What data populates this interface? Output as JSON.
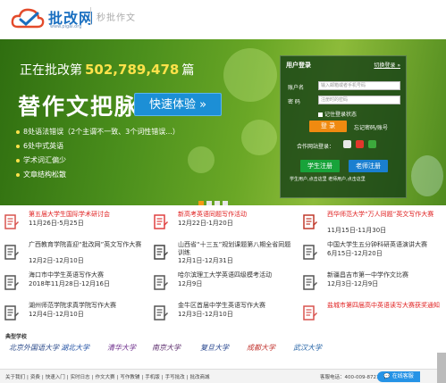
{
  "header": {
    "logo_text": "批改网",
    "logo_url": "www.pigai.org",
    "slogan": "秒批作文"
  },
  "banner": {
    "counter_prefix": "正在批改第",
    "counter_number": "502,789,478",
    "counter_suffix": "篇",
    "headline": "替作文把脉",
    "cta_label": "快速体验 »",
    "features": [
      "8处语法错误（2个主谓不一致、3个词性错误...）",
      "6处中式英语",
      "学术词汇偏少",
      "文章结构松散"
    ],
    "slide_count": 4,
    "active_slide": 0
  },
  "login": {
    "title": "用户登录",
    "switch_link": "切换登录 »",
    "account_label": "账户名",
    "account_placeholder": "输入邮箱或者手机号码",
    "password_label": "密 码",
    "password_placeholder": "注册时的密码",
    "remember_label": "记住登录状态",
    "login_button": "登 录",
    "forgot_link": "忘记密码/账号",
    "partner_label": "合作网站登录：",
    "student_register": "学生注册",
    "teacher_register": "老师注册",
    "register_links": "学生用户,点击这里 老师用户,点击这里"
  },
  "news": [
    {
      "title": "第五届大学生国际学术研讨会",
      "date": "11月26日-5月25日",
      "red": true,
      "icon": "#d9534f"
    },
    {
      "title": "新高考英语同题写作活动",
      "date": "12月22日-1月20日",
      "red": true,
      "icon": "#e04040"
    },
    {
      "title": "西华师范大学“万人同题”英文写作大赛",
      "date": "11月15日-11月30日",
      "red": true,
      "icon": "#c0392b"
    },
    {
      "title": "广西教育学院喜迎“批改网”英文写作大赛",
      "date": "12月2日-12月10日",
      "red": false,
      "icon": "#555555"
    },
    {
      "title": "山西省“十三五”规划课题第八期全省同题训练",
      "date": "12月1日-12月31日",
      "red": false,
      "icon": "#444444"
    },
    {
      "title": "中国大学生五分钟科研英语演讲大赛",
      "date": "6月15日-12月20日",
      "red": false,
      "icon": "#555555"
    },
    {
      "title": "海口市中学生英语写作大赛",
      "date": "2018年11月28日-12月16日",
      "red": false,
      "icon": "#555555"
    },
    {
      "title": "哈尔滨理工大学英语四级模考活动",
      "date": "12月9日",
      "red": false,
      "icon": "#555555"
    },
    {
      "title": "新疆昌吉市第一中学作文比赛",
      "date": "12月3日-12月9日",
      "red": false,
      "icon": "#555555"
    },
    {
      "title": "湖州师范学院求真学院写作大赛",
      "date": "12月4日-12月10日",
      "red": false,
      "icon": "#555555"
    },
    {
      "title": "金牛区首届中学生英语写作大赛",
      "date": "12月3日-12月10日",
      "red": false,
      "icon": "#555555"
    },
    {
      "title": "盐城市第四届高中英语读写大赛获奖通知",
      "date": "",
      "red": true,
      "icon": "#d9534f"
    }
  ],
  "schools": {
    "title": "典型学校",
    "items": [
      {
        "name": "北京外国语大学",
        "color": "#2b4a8a"
      },
      {
        "name": "湖北大学",
        "color": "#1f4fa3"
      },
      {
        "name": "清华大学",
        "color": "#6b2a8a"
      },
      {
        "name": "南京大学",
        "color": "#5a2a6b"
      },
      {
        "name": "复旦大学",
        "color": "#1f3f8a"
      },
      {
        "name": "成都大学",
        "color": "#c0302b"
      },
      {
        "name": "武汉大学",
        "color": "#1f5fa3"
      }
    ]
  },
  "footer": {
    "links": [
      "关于我们",
      "资费",
      "快速入门",
      "实时日志",
      "作文大赛",
      "写作教辅",
      "手机版",
      "手写批改",
      "批改商城"
    ],
    "hotline": "客服电话：400-009-8721",
    "service_button": "在线客服"
  },
  "colors": {
    "brand_blue": "#1a6fc0",
    "cta_blue": "#1c8fd6",
    "login_orange": "#f08a10",
    "student_green": "#18a33a",
    "teacher_blue": "#1a7fd0",
    "counter_yellow": "#ffe24a",
    "news_red": "#e02020"
  }
}
